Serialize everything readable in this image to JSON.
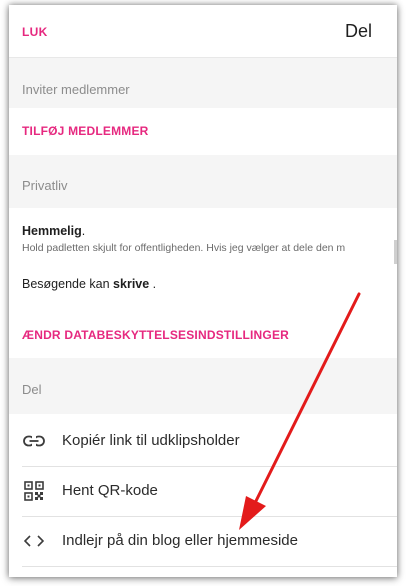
{
  "header": {
    "close_label": "LUK",
    "title": "Del"
  },
  "members": {
    "section_label": "Inviter medlemmer",
    "add_label": "TILFØJ MEDLEMMER"
  },
  "privacy": {
    "section_label": "Privatliv",
    "mode_title": "Hemmelig",
    "mode_title_suffix": ".",
    "mode_desc": "Hold padletten skjult for offentligheden. Hvis jeg vælger at dele den m",
    "visitor_prefix": "Besøgende kan ",
    "visitor_perm": "skrive",
    "visitor_suffix": " .",
    "change_label": "ÆNDR DATABESKYTTELSESINDSTILLINGER"
  },
  "share": {
    "section_label": "Del",
    "items": [
      {
        "label": "Kopiér link til udklipsholder",
        "icon": "link-icon"
      },
      {
        "label": "Hent QR-kode",
        "icon": "qr-code-icon"
      },
      {
        "label": "Indlejr på din blog eller hjemmeside",
        "icon": "code-brackets-icon"
      }
    ]
  },
  "colors": {
    "accent": "#e6287f",
    "annotation_arrow": "#e31b1b"
  }
}
